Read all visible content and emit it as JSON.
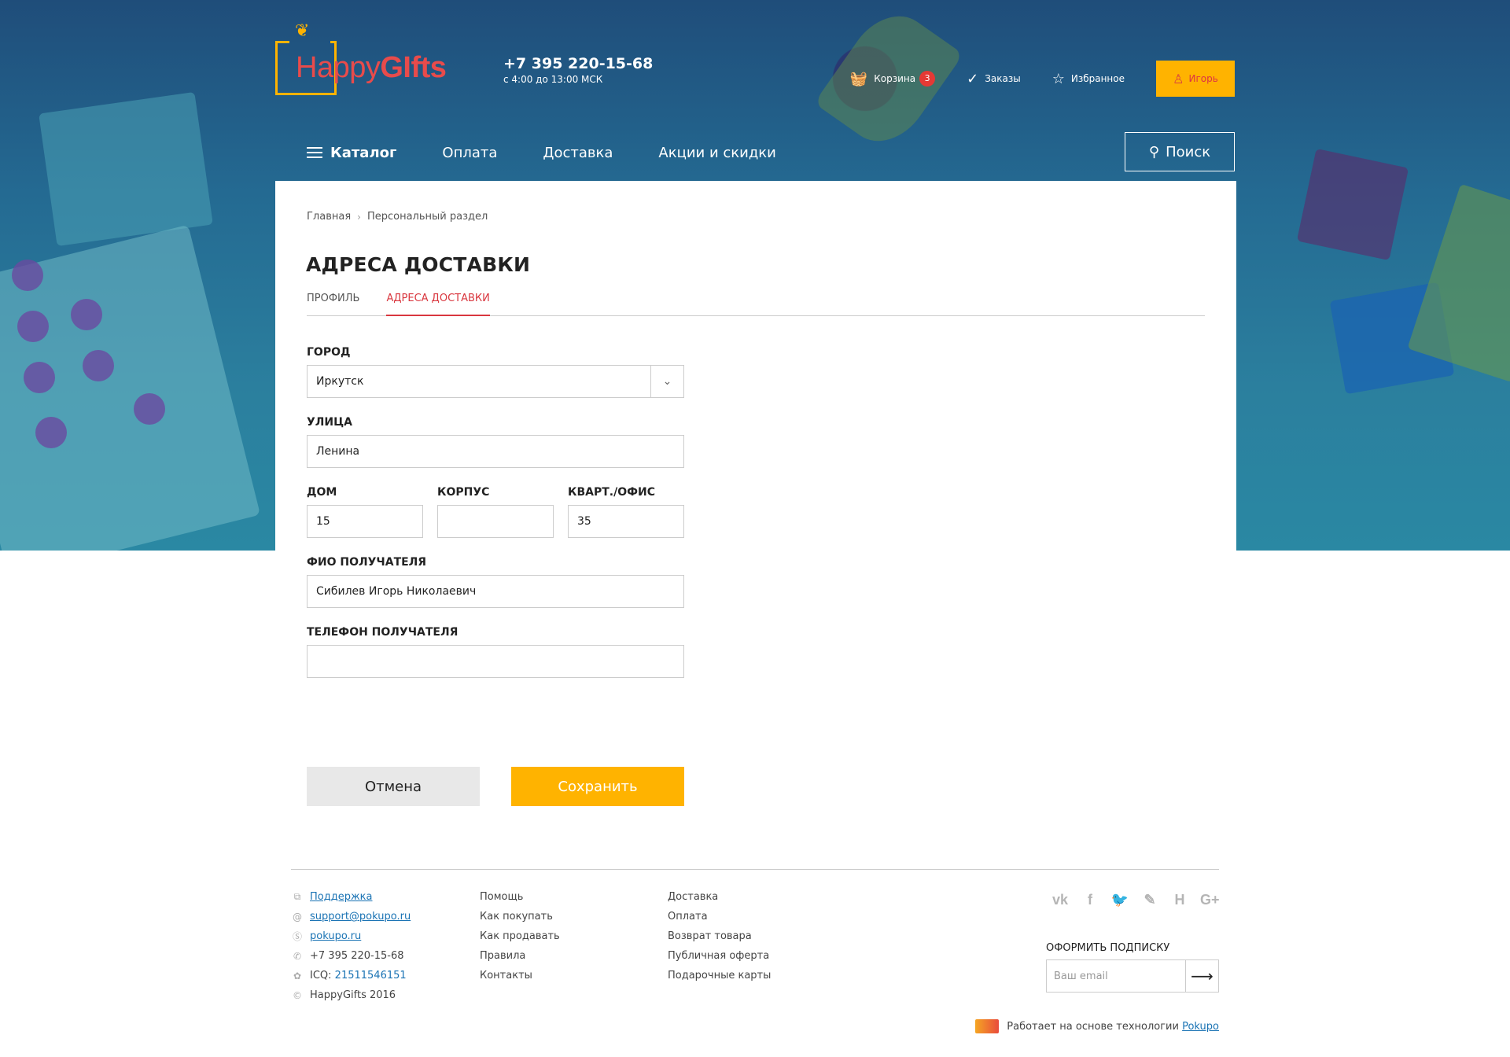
{
  "header": {
    "logo_part1": "Happy",
    "logo_part2": "GIfts",
    "phone": "+7 395 220-15-68",
    "hours": "с 4:00 до 13:00 МСК",
    "cart_label": "Корзина",
    "cart_count": "3",
    "orders_label": "Заказы",
    "favorites_label": "Избранное",
    "user_label": "Игорь"
  },
  "nav": {
    "catalog": "Каталог",
    "items": [
      "Оплата",
      "Доставка",
      "Акции и скидки"
    ],
    "search": "Поиск"
  },
  "breadcrumb": [
    "Главная",
    "Персональный раздел"
  ],
  "page_title": "АДРЕСА ДОСТАВКИ",
  "tabs": [
    {
      "label": "ПРОФИЛЬ",
      "active": false
    },
    {
      "label": "АДРЕСА ДОСТАВКИ",
      "active": true
    }
  ],
  "form": {
    "city_label": "ГОРОД",
    "city_value": "Иркутск",
    "street_label": "УЛИЦА",
    "street_value": "Ленина",
    "house_label": "ДОМ",
    "house_value": "15",
    "building_label": "КОРПУС",
    "building_value": "",
    "flat_label": "КВАРТ./ОФИС",
    "flat_value": "35",
    "recipient_label": "ФИО ПОЛУЧАТЕЛЯ",
    "recipient_value": "Сибилев Игорь Николаевич",
    "phone_label": "ТЕЛЕФОН ПОЛУЧАТЕЛЯ",
    "phone_value": ""
  },
  "buttons": {
    "cancel": "Отмена",
    "save": "Сохранить"
  },
  "footer": {
    "contacts": {
      "support": "Поддержка",
      "email": "support@pokupo.ru",
      "skype": "pokupo.ru",
      "phone": "+7 395 220-15-68",
      "icq_label": "ICQ:",
      "icq_value": "21511546151",
      "copyright": "HappyGifts 2016"
    },
    "col2": [
      "Помощь",
      "Как покупать",
      "Как продавать",
      "Правила",
      "Контакты"
    ],
    "col3": [
      "Доставка",
      "Оплата",
      "Возврат товара",
      "Публичная оферта",
      "Подарочные карты"
    ],
    "social_icons": [
      "vk-icon",
      "facebook-icon",
      "twitter-icon",
      "feather-icon",
      "h-icon",
      "googleplus-icon"
    ],
    "subscribe_label": "ОФОРМИТЬ ПОДПИСКУ",
    "subscribe_placeholder": "Ваш email",
    "powered_text": "Работает на основе технологии",
    "powered_link": "Pokupo"
  },
  "colors": {
    "accent": "#ffb300",
    "active_tab": "#d9363e",
    "link": "#1a73b4",
    "badge": "#e53935"
  }
}
